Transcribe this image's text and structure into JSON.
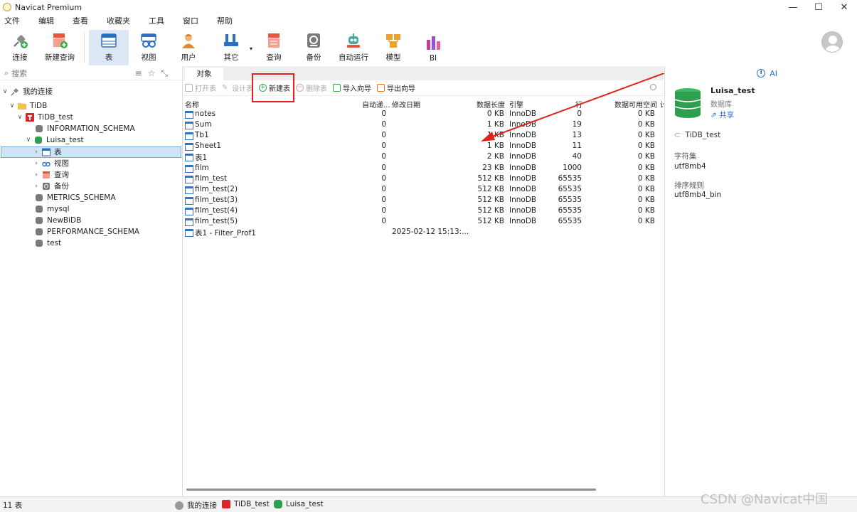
{
  "window": {
    "title": "Navicat Premium",
    "minimize": "—",
    "maximize": "☐",
    "close": "✕"
  },
  "menu": [
    "文件",
    "编辑",
    "查看",
    "收藏夹",
    "工具",
    "窗口",
    "帮助"
  ],
  "toolbar": {
    "connect": "连接",
    "new_query": "新建查询",
    "table": "表",
    "view": "视图",
    "user": "用户",
    "other": "其它",
    "query": "查询",
    "backup": "备份",
    "automation": "自动运行",
    "model": "模型",
    "bi": "BI"
  },
  "sidebar": {
    "search_placeholder": "搜索",
    "tree": {
      "my_connections": "我的连接",
      "tidb": "TiDB",
      "tidb_test": "TiDB_test",
      "information_schema": "INFORMATION_SCHEMA",
      "luisa_test": "Luisa_test",
      "tables": "表",
      "views": "视图",
      "queries": "查询",
      "backups": "备份",
      "metrics_schema": "METRICS_SCHEMA",
      "mysql": "mysql",
      "newbidb": "NewBiDB",
      "performance_schema": "PERFORMANCE_SCHEMA",
      "test": "test"
    }
  },
  "main": {
    "tab": "对象",
    "actions": {
      "open_table": "打开表",
      "design_table": "设计表",
      "new_table": "新建表",
      "delete_table": "删除表",
      "import_wizard": "导入向导",
      "export_wizard": "导出向导"
    },
    "columns": {
      "name": "名称",
      "auto_inc": "自动递...",
      "modified": "修改日期",
      "data_length": "数据长度",
      "engine": "引擎",
      "rows": "行",
      "data_free": "数据可用空间",
      "more": "计"
    },
    "rows": [
      {
        "name": "notes",
        "auto_inc": "0",
        "modified": "",
        "data_length": "0 KB",
        "engine": "InnoDB",
        "rows": "0",
        "data_free": "0 KB"
      },
      {
        "name": "Sum",
        "auto_inc": "0",
        "modified": "",
        "data_length": "1 KB",
        "engine": "InnoDB",
        "rows": "19",
        "data_free": "0 KB"
      },
      {
        "name": "Tb1",
        "auto_inc": "0",
        "modified": "",
        "data_length": "1 KB",
        "engine": "InnoDB",
        "rows": "13",
        "data_free": "0 KB"
      },
      {
        "name": "Sheet1",
        "auto_inc": "0",
        "modified": "",
        "data_length": "1 KB",
        "engine": "InnoDB",
        "rows": "11",
        "data_free": "0 KB"
      },
      {
        "name": "表1",
        "auto_inc": "0",
        "modified": "",
        "data_length": "2 KB",
        "engine": "InnoDB",
        "rows": "40",
        "data_free": "0 KB"
      },
      {
        "name": "film",
        "auto_inc": "0",
        "modified": "",
        "data_length": "23 KB",
        "engine": "InnoDB",
        "rows": "1000",
        "data_free": "0 KB"
      },
      {
        "name": "film_test",
        "auto_inc": "0",
        "modified": "",
        "data_length": "512 KB",
        "engine": "InnoDB",
        "rows": "65535",
        "data_free": "0 KB"
      },
      {
        "name": "film_test(2)",
        "auto_inc": "0",
        "modified": "",
        "data_length": "512 KB",
        "engine": "InnoDB",
        "rows": "65535",
        "data_free": "0 KB"
      },
      {
        "name": "film_test(3)",
        "auto_inc": "0",
        "modified": "",
        "data_length": "512 KB",
        "engine": "InnoDB",
        "rows": "65535",
        "data_free": "0 KB"
      },
      {
        "name": "film_test(4)",
        "auto_inc": "0",
        "modified": "",
        "data_length": "512 KB",
        "engine": "InnoDB",
        "rows": "65535",
        "data_free": "0 KB"
      },
      {
        "name": "film_test(5)",
        "auto_inc": "0",
        "modified": "",
        "data_length": "512 KB",
        "engine": "InnoDB",
        "rows": "65535",
        "data_free": "0 KB"
      },
      {
        "name": "表1 - Filter_Prof1",
        "auto_inc": "",
        "modified": "2025-02-12 15:13:...",
        "data_length": "",
        "engine": "",
        "rows": "",
        "data_free": ""
      }
    ]
  },
  "info_panel": {
    "ai": "AI",
    "db_name": "Luisa_test",
    "db_type": "数据库",
    "share": "共享",
    "connection": "TiDB_test",
    "charset_label": "字符集",
    "charset": "utf8mb4",
    "collation_label": "排序规则",
    "collation": "utf8mb4_bin"
  },
  "status": {
    "count": "11 表",
    "crumb_connections": "我的连接",
    "crumb_connection": "TiDB_test",
    "crumb_db": "Luisa_test"
  },
  "watermark": "CSDN @Navicat中国",
  "colors": {
    "accent": "#2a72c7",
    "highlight_red": "#e0241c",
    "selection": "#cfe3f7"
  }
}
